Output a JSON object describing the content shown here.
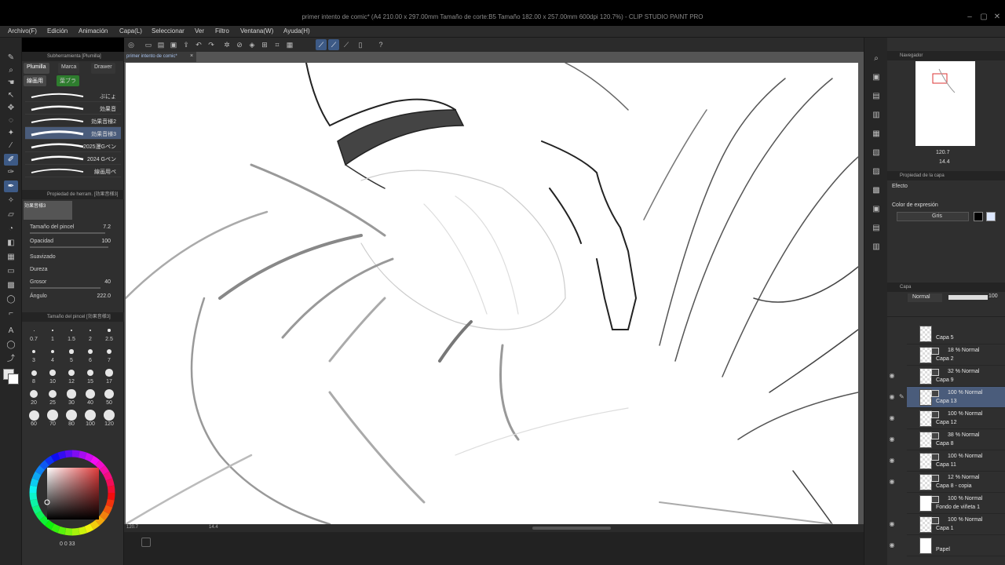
{
  "window": {
    "title": "primer intento de comic* (A4 210.00 x 297.00mm Tamaño de corte:B5 Tamaño 182.00 x 257.00mm 600dpi 120.7%) - CLIP STUDIO PAINT PRO"
  },
  "menu": [
    "Archivo(F)",
    "Edición",
    "Animación",
    "Capa(L)",
    "Seleccionar",
    "Ver",
    "Filtro",
    "Ventana(W)",
    "Ayuda(H)"
  ],
  "document": {
    "tab": "primer intento de comic*"
  },
  "subtool_panel": {
    "header": "Subherramienta [Plumilla]",
    "tabs": [
      "Plumilla",
      "Marca",
      "Drawer"
    ],
    "subtabs": [
      "線画用",
      "葉ブラ"
    ],
    "brushes": [
      "ぶにょ",
      "効果音",
      "効果音様2",
      "効果音様3",
      "2025漫Gペン",
      "2024 Gペン",
      "線画用ペ"
    ],
    "selected_brush": 3
  },
  "tool_property": {
    "header": "Propiedad de herram. [効果音様3]",
    "brush_name": "効果音様3",
    "props": [
      {
        "label": "Tamaño del pincel",
        "value": "7.2"
      },
      {
        "label": "Opacidad",
        "value": "100"
      },
      {
        "label": "Suavizado",
        "value": ""
      },
      {
        "label": "Dureza",
        "value": ""
      },
      {
        "label": "Grosor",
        "value": "40"
      },
      {
        "label": "Ángulo",
        "value": "222.0"
      }
    ]
  },
  "brush_size": {
    "header": "Tamaño del pincel [効果音様3]",
    "sizes": [
      "0.7",
      "1",
      "1.5",
      "2",
      "2.5",
      "3",
      "4",
      "5",
      "6",
      "7",
      "8",
      "10",
      "12",
      "15",
      "17",
      "20",
      "25",
      "30",
      "40",
      "50",
      "60",
      "70",
      "80",
      "100",
      "120"
    ]
  },
  "colors": {
    "accent": "#3d5a86",
    "selected_row": "#4a5c7b",
    "panel": "#2f2f2f",
    "color_wheel_hue": "#e03b3b"
  },
  "canvas_status": {
    "zoom": "120.7",
    "angle": "14.4"
  },
  "color_info": {
    "values": "0 0 33"
  },
  "navigator": {
    "header": "Navegador",
    "zoom": "120.7",
    "angle": "14.4"
  },
  "layer_property": {
    "header": "Propiedad de la capa",
    "effect_label": "Efecto",
    "expression_label": "Color de expresión",
    "expression_value": "Gris"
  },
  "layers_panel": {
    "header": "Capa",
    "blend_mode": "Normal",
    "opacity": "100",
    "layers": [
      {
        "mode": "",
        "name": "Capa 5",
        "visible": false
      },
      {
        "mode": "18 % Normal",
        "name": "Capa 2",
        "visible": false
      },
      {
        "mode": "32 % Normal",
        "name": "Capa 9",
        "visible": true
      },
      {
        "mode": "100 % Normal",
        "name": "Capa 13",
        "visible": true,
        "selected": true
      },
      {
        "mode": "100 % Normal",
        "name": "Capa 12",
        "visible": true
      },
      {
        "mode": "38 % Normal",
        "name": "Capa 8",
        "visible": true
      },
      {
        "mode": "100 % Normal",
        "name": "Capa 11",
        "visible": true
      },
      {
        "mode": "12 % Normal",
        "name": "Capa 8 - copia",
        "visible": true
      },
      {
        "mode": "100 % Normal",
        "name": "Fondo de viñeta 1",
        "visible": false
      },
      {
        "mode": "100 % Normal",
        "name": "Capa 1",
        "visible": true
      },
      {
        "mode": "",
        "name": "Papel",
        "visible": true
      }
    ]
  }
}
